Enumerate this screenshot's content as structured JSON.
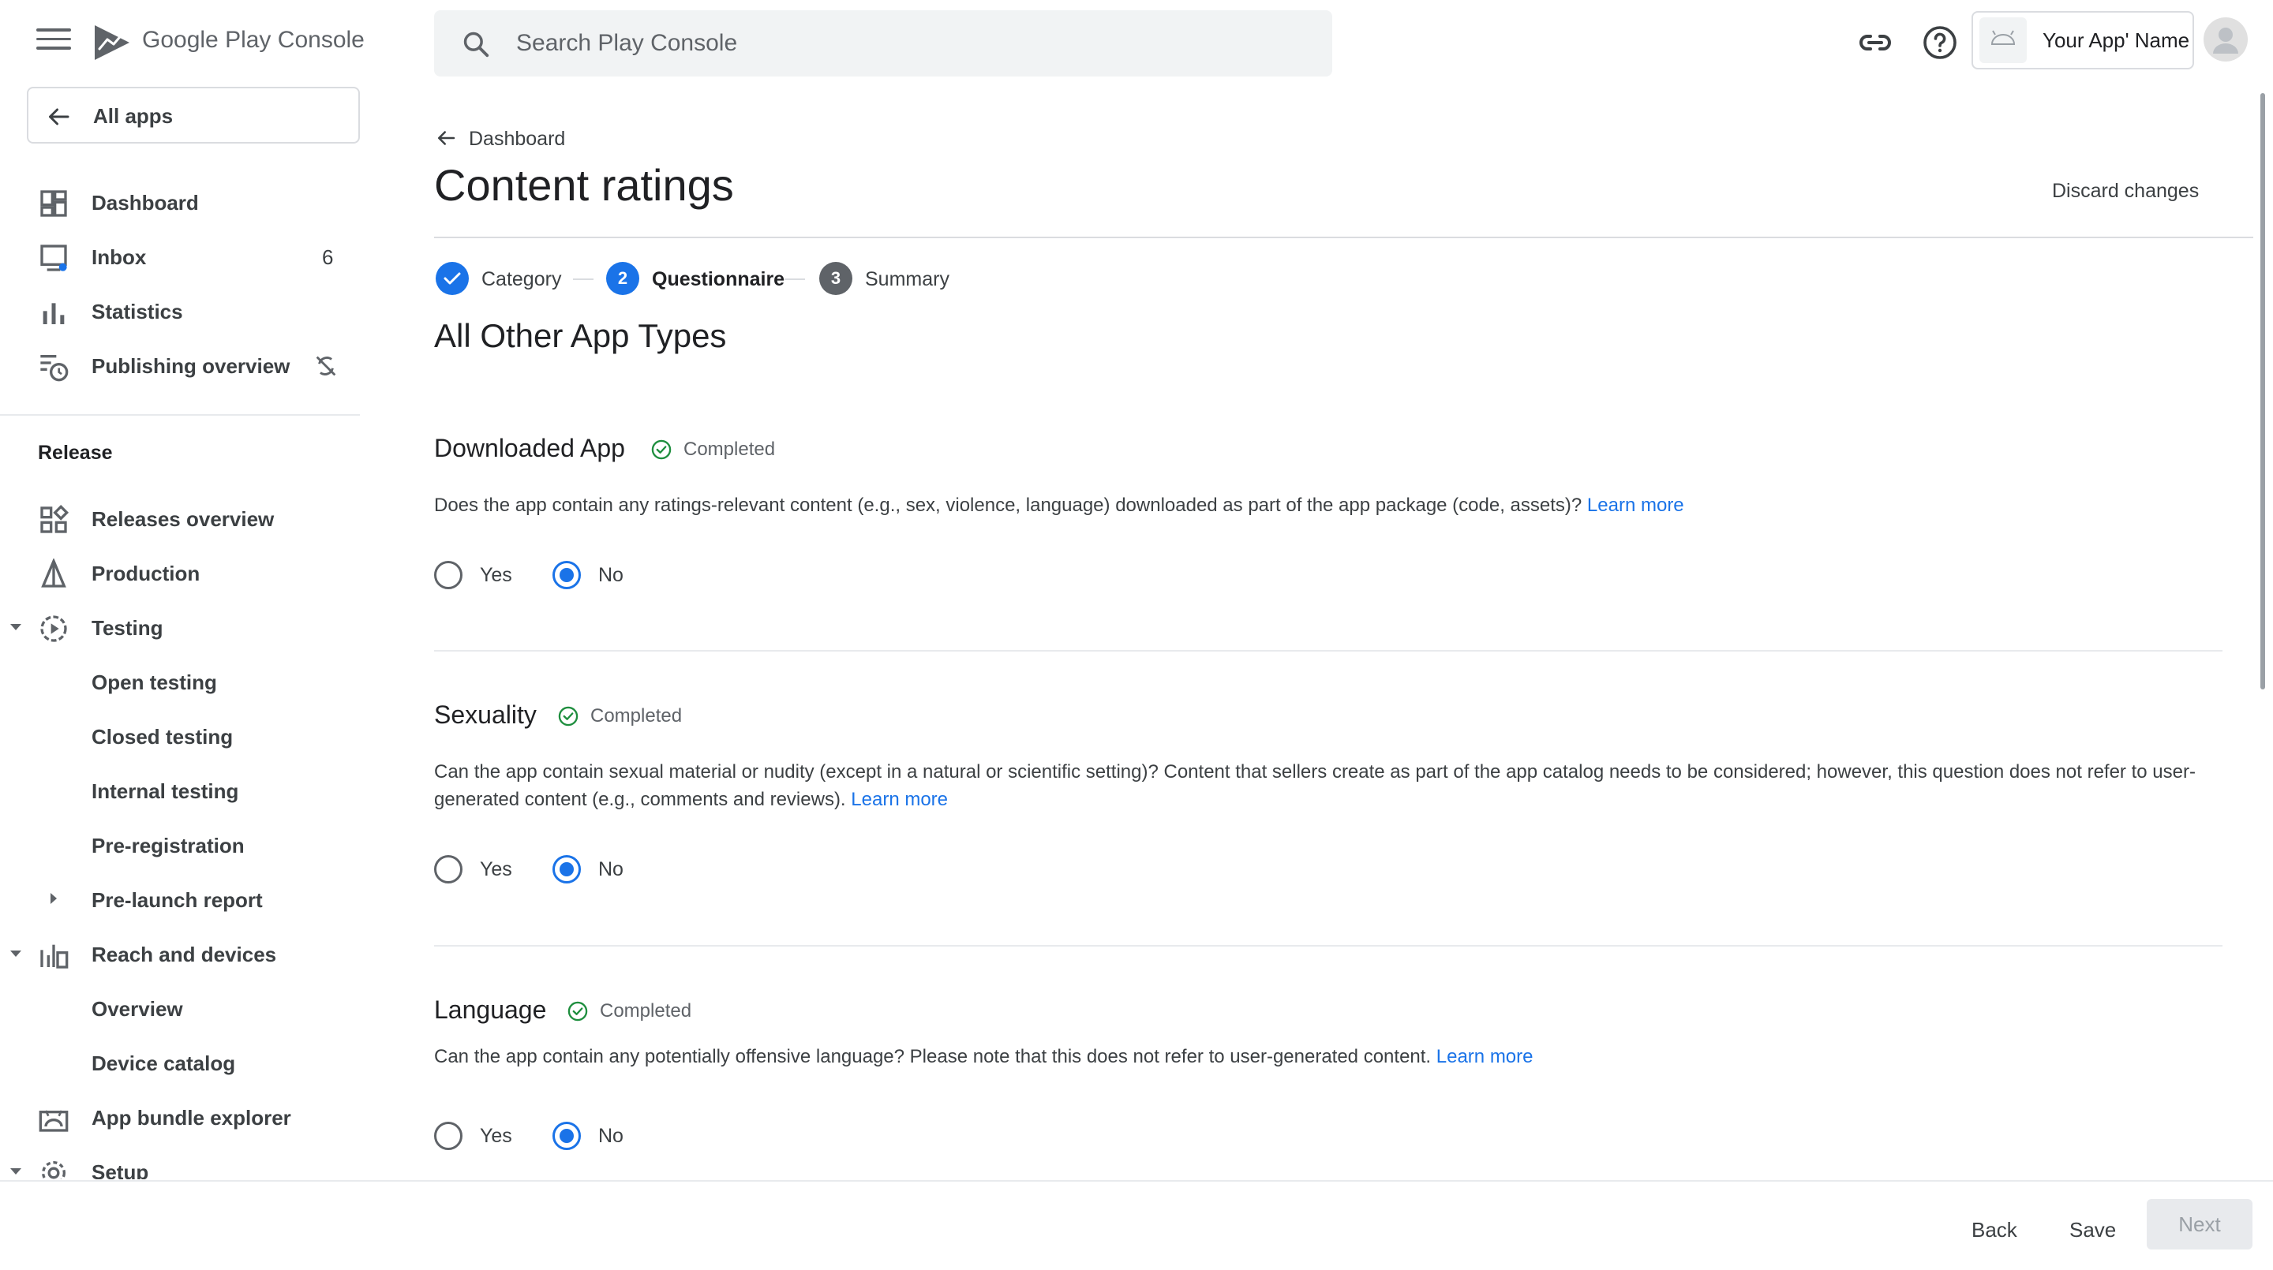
{
  "header": {
    "brand_google": "Google Play",
    "brand_console": "Console",
    "search_placeholder": "Search Play Console",
    "app_name": "Your App' Name"
  },
  "sidebar": {
    "all_apps": "All apps",
    "top_items": [
      {
        "label": "Dashboard"
      },
      {
        "label": "Inbox",
        "count": "6"
      },
      {
        "label": "Statistics"
      },
      {
        "label": "Publishing overview"
      }
    ],
    "section_release": "Release",
    "release_items": [
      {
        "label": "Releases overview"
      },
      {
        "label": "Production"
      },
      {
        "label": "Testing"
      },
      {
        "label": "Open testing"
      },
      {
        "label": "Closed testing"
      },
      {
        "label": "Internal testing"
      },
      {
        "label": "Pre-registration"
      },
      {
        "label": "Pre-launch report"
      },
      {
        "label": "Reach and devices"
      },
      {
        "label": "Overview"
      },
      {
        "label": "Device catalog"
      },
      {
        "label": "App bundle explorer"
      },
      {
        "label": "Setup"
      }
    ]
  },
  "main": {
    "breadcrumb": "Dashboard",
    "title": "Content ratings",
    "discard": "Discard changes",
    "steps": [
      {
        "num": "",
        "label": "Category",
        "state": "done"
      },
      {
        "num": "2",
        "label": "Questionnaire",
        "state": "active"
      },
      {
        "num": "3",
        "label": "Summary",
        "state": "pending"
      }
    ],
    "section_heading": "All Other App Types",
    "questions": [
      {
        "title": "Downloaded App",
        "status": "Completed",
        "text": "Does the app contain any ratings-relevant content (e.g., sex, violence, language) downloaded as part of the app package (code, assets)?",
        "learn_more": "Learn more",
        "yes": "Yes",
        "no": "No",
        "answer": "No"
      },
      {
        "title": "Sexuality",
        "status": "Completed",
        "text": "Can the app contain sexual material or nudity (except in a natural or scientific setting)? Content that sellers create as part of the app catalog needs to be considered; however, this question does not refer to user-generated content (e.g., comments and reviews).",
        "learn_more": "Learn more",
        "yes": "Yes",
        "no": "No",
        "answer": "No"
      },
      {
        "title": "Language",
        "status": "Completed",
        "text": "Can the app contain any potentially offensive language? Please note that this does not refer to user-generated content.",
        "learn_more": "Learn more",
        "yes": "Yes",
        "no": "No",
        "answer": "No"
      }
    ]
  },
  "footer": {
    "back": "Back",
    "save": "Save",
    "next": "Next"
  },
  "colors": {
    "accent": "#1a73e8",
    "completed_green": "#1e8e3e",
    "step_pending": "#5f6368"
  }
}
